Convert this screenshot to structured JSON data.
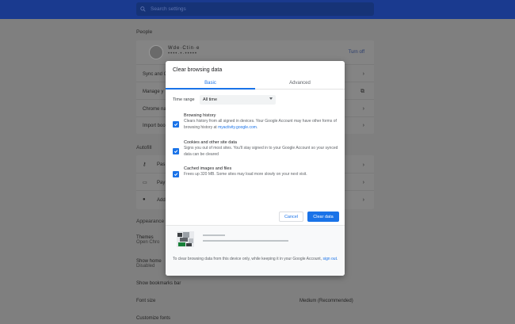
{
  "search": {
    "placeholder": "Search settings"
  },
  "people": {
    "heading": "People",
    "profile_name": "Wde·Ctin·e",
    "profile_sub": "••••·•·•••••",
    "turn_off": "Turn off",
    "rows": [
      "Sync and G",
      "Manage y",
      "Chrome na",
      "Import boo"
    ]
  },
  "autofill": {
    "heading": "Autofill",
    "rows": [
      "Pas",
      "Pay",
      "Add"
    ]
  },
  "appearance": {
    "heading": "Appearance",
    "themes": "Themes",
    "themes_sub": "Open Chro",
    "show_home": "Show home",
    "show_home_sub": "Disabled",
    "show_bookmarks": "Show bookmarks bar",
    "font_size": "Font size",
    "font_size_value": "Medium (Recommended)",
    "customize_fonts": "Customize fonts"
  },
  "dialog": {
    "title": "Clear browsing data",
    "tabs": [
      {
        "label": "Basic",
        "active": true
      },
      {
        "label": "Advanced",
        "active": false
      }
    ],
    "time_range_label": "Time range",
    "time_range_value": "All time",
    "options": [
      {
        "title": "Browsing history",
        "desc_before": "Clears history from all signed in devices. Your Google Account may have other forms of browsing history at ",
        "link": "myactivity.google.com",
        "desc_after": ".",
        "checked": true
      },
      {
        "title": "Cookies and other site data",
        "desc_before": "Signs you out of most sites. You'll stay signed in to your Google Account so your synced data can be cleared",
        "link": "",
        "desc_after": "",
        "checked": true
      },
      {
        "title": "Cached images and files",
        "desc_before": "Frees up 320 MB. Some sites may load more slowly on your next visit.",
        "link": "",
        "desc_after": "",
        "checked": true
      }
    ],
    "cancel_label": "Cancel",
    "clear_label": "Clear data",
    "footer_text": "To clear browsing data from this device only, while keeping it in your Google Account, ",
    "footer_link": "sign out",
    "footer_end": "."
  },
  "colors": {
    "accent": "#1a73e8",
    "topbar": "#1a3a8f"
  }
}
